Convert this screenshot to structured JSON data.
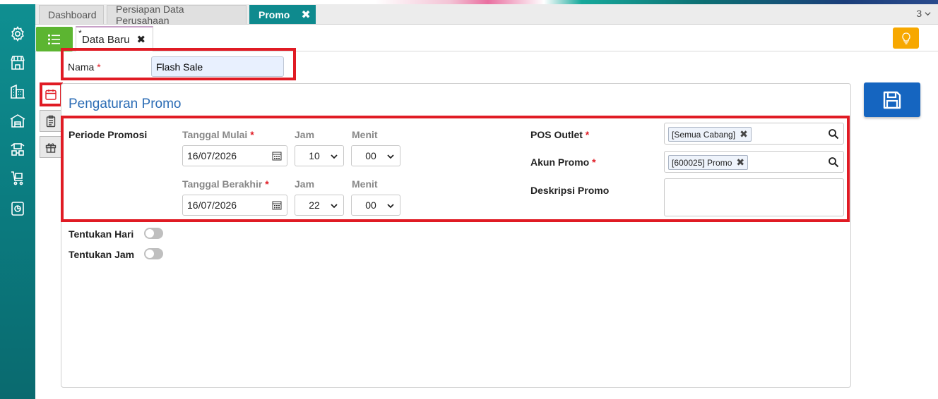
{
  "tabs": [
    {
      "label": "Dashboard"
    },
    {
      "label": "Persiapan Data Perusahaan"
    },
    {
      "label": "Promo",
      "close": "✖"
    }
  ],
  "tab_count": "3",
  "subtab": {
    "star": "*",
    "label": "Data Baru",
    "close": "✖"
  },
  "form": {
    "nama_label": "Nama",
    "nama_value": "Flash Sale",
    "required_mark": "*"
  },
  "panel": {
    "title": "Pengaturan Promo",
    "periode_label": "Periode Promosi",
    "tanggal_mulai_label": "Tanggal Mulai",
    "tanggal_mulai_value": "16/07/2026",
    "jam_label": "Jam",
    "menit_label": "Menit",
    "jam_mulai": "10",
    "menit_mulai": "00",
    "tanggal_berakhir_label": "Tanggal Berakhir",
    "tanggal_berakhir_value": "16/07/2026",
    "jam_berakhir": "22",
    "menit_berakhir": "00",
    "pos_outlet_label": "POS Outlet",
    "pos_outlet_chip": "[Semua Cabang]",
    "akun_promo_label": "Akun Promo",
    "akun_promo_chip": "[600025] Promo",
    "deskripsi_label": "Deskripsi Promo",
    "tentukan_hari_label": "Tentukan Hari",
    "tentukan_jam_label": "Tentukan Jam"
  },
  "chip_close": "✖",
  "colors": {
    "sidebar": "#0e8a8e",
    "accent_green": "#5cb531",
    "save_blue": "#1565c0",
    "bulb_orange": "#f7a800",
    "highlight_red": "#e01b24",
    "title_blue": "#2b6cb5"
  },
  "icons": [
    "settings-icon",
    "store-icon",
    "building-icon",
    "warehouse-icon",
    "inventory-icon",
    "cart-icon",
    "report-icon",
    "list-menu-icon",
    "lightbulb-icon",
    "calendar-icon",
    "clipboard-icon",
    "gift-icon",
    "save-icon",
    "search-icon"
  ]
}
